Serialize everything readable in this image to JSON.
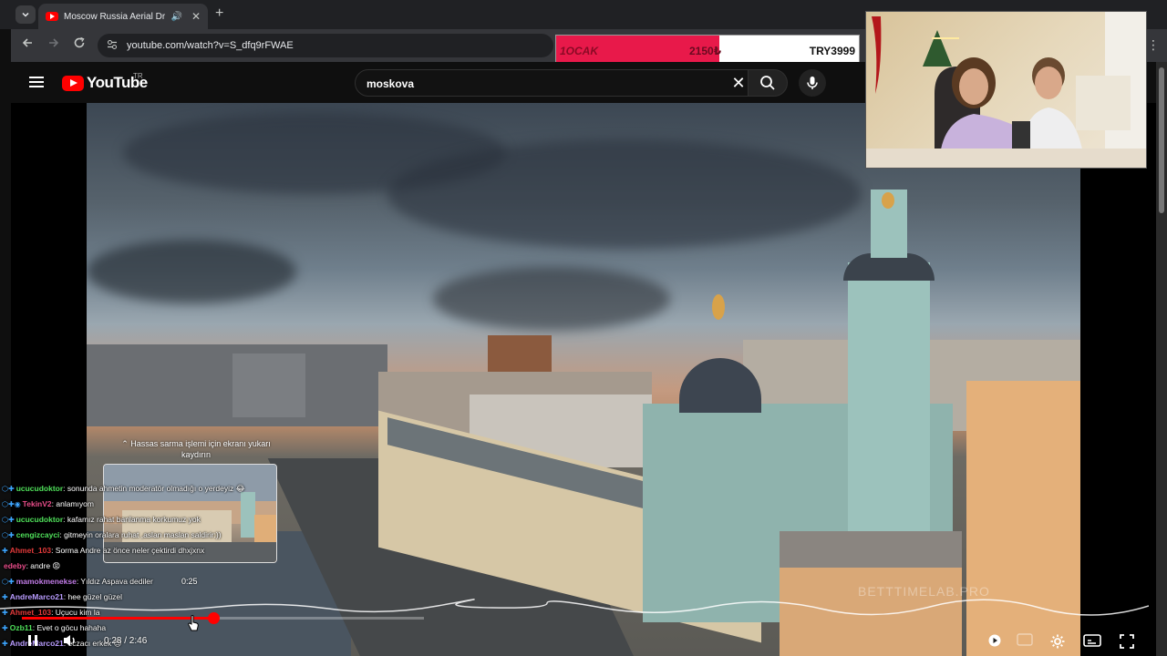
{
  "browser": {
    "tab_title": "Moscow Russia Aerial Drone",
    "url": "youtube.com/watch?v=S_dfq9rFWAE",
    "new_tab_symbol": "+",
    "tab_close_symbol": "✕"
  },
  "donation_bar": {
    "goal_label": "1OCAK",
    "current_amount": "2150₺",
    "target_label": "TRY3999",
    "progress_fraction": 0.54,
    "fill_color": "#e8194a"
  },
  "youtube": {
    "logo_text": "YouTube",
    "region": "TR",
    "search_query": "moskova",
    "accent_color": "#ff0000"
  },
  "video": {
    "watermark": "BETTTIMELAB.PRO",
    "preview_hint": "Hassas sarma işlemi için ekranı yukarı kaydırın",
    "hover_time": "0:25",
    "current_time": "0:28",
    "duration": "2:46",
    "time_display": "0:28 / 2:46",
    "progress_fraction": 0.478
  },
  "chat": [
    {
      "user": "ucucudoktor",
      "text": ": sonunda ahmetin moderatör olmadığı o yerdeyiz 😂",
      "color": "#4fe05a",
      "badges": "⬡✚"
    },
    {
      "user": "TekinV2",
      "text": ": anlamıyom",
      "color": "#e84d8a",
      "badges": "⬡✚◉"
    },
    {
      "user": "ucucudoktor",
      "text": ": kafamız rahat banlanma korkumuz yok",
      "color": "#4fe05a",
      "badges": "⬡✚"
    },
    {
      "user": "cengizcayci",
      "text": ": gitmeyin oralara ruhat ,aslan maslan saldirir:))",
      "color": "#4fe05a",
      "badges": "⬡✚"
    },
    {
      "user": "Ahmet_103",
      "text": ": Sorma Andre az önce neler çektirdi dhxjxnx",
      "color": "#e23a3a",
      "badges": "✚"
    },
    {
      "user": "edeby",
      "text": ": andre 😡",
      "color": "#e84d8a",
      "badges": ""
    },
    {
      "user": "mamokmenekse",
      "text": ": Yıldız Aspava dediler",
      "color": "#c27ce8",
      "badges": "⬡✚"
    },
    {
      "user": "AndreMarco21",
      "text": ": hee güzel güzel",
      "color": "#b99cff",
      "badges": "✚"
    },
    {
      "user": "Ahmet_103",
      "text": ": Uçucu kim la",
      "color": "#e23a3a",
      "badges": "✚"
    },
    {
      "user": "Ozb11",
      "text": ": Evet o göcu hahaha",
      "color": "#4fe05a",
      "badges": "✚"
    },
    {
      "user": "AndreMarco21",
      "text": ": eczacı erkek 😊",
      "color": "#b99cff",
      "badges": "✚"
    }
  ],
  "icons": {
    "tab_list": "chevron-down-icon",
    "back": "arrow-left-icon",
    "forward": "arrow-right-icon",
    "reload": "reload-icon",
    "search": "search-icon",
    "mic": "mic-icon",
    "play": "play-icon",
    "settings": "gear-icon",
    "fullscreen": "fullscreen-icon"
  }
}
